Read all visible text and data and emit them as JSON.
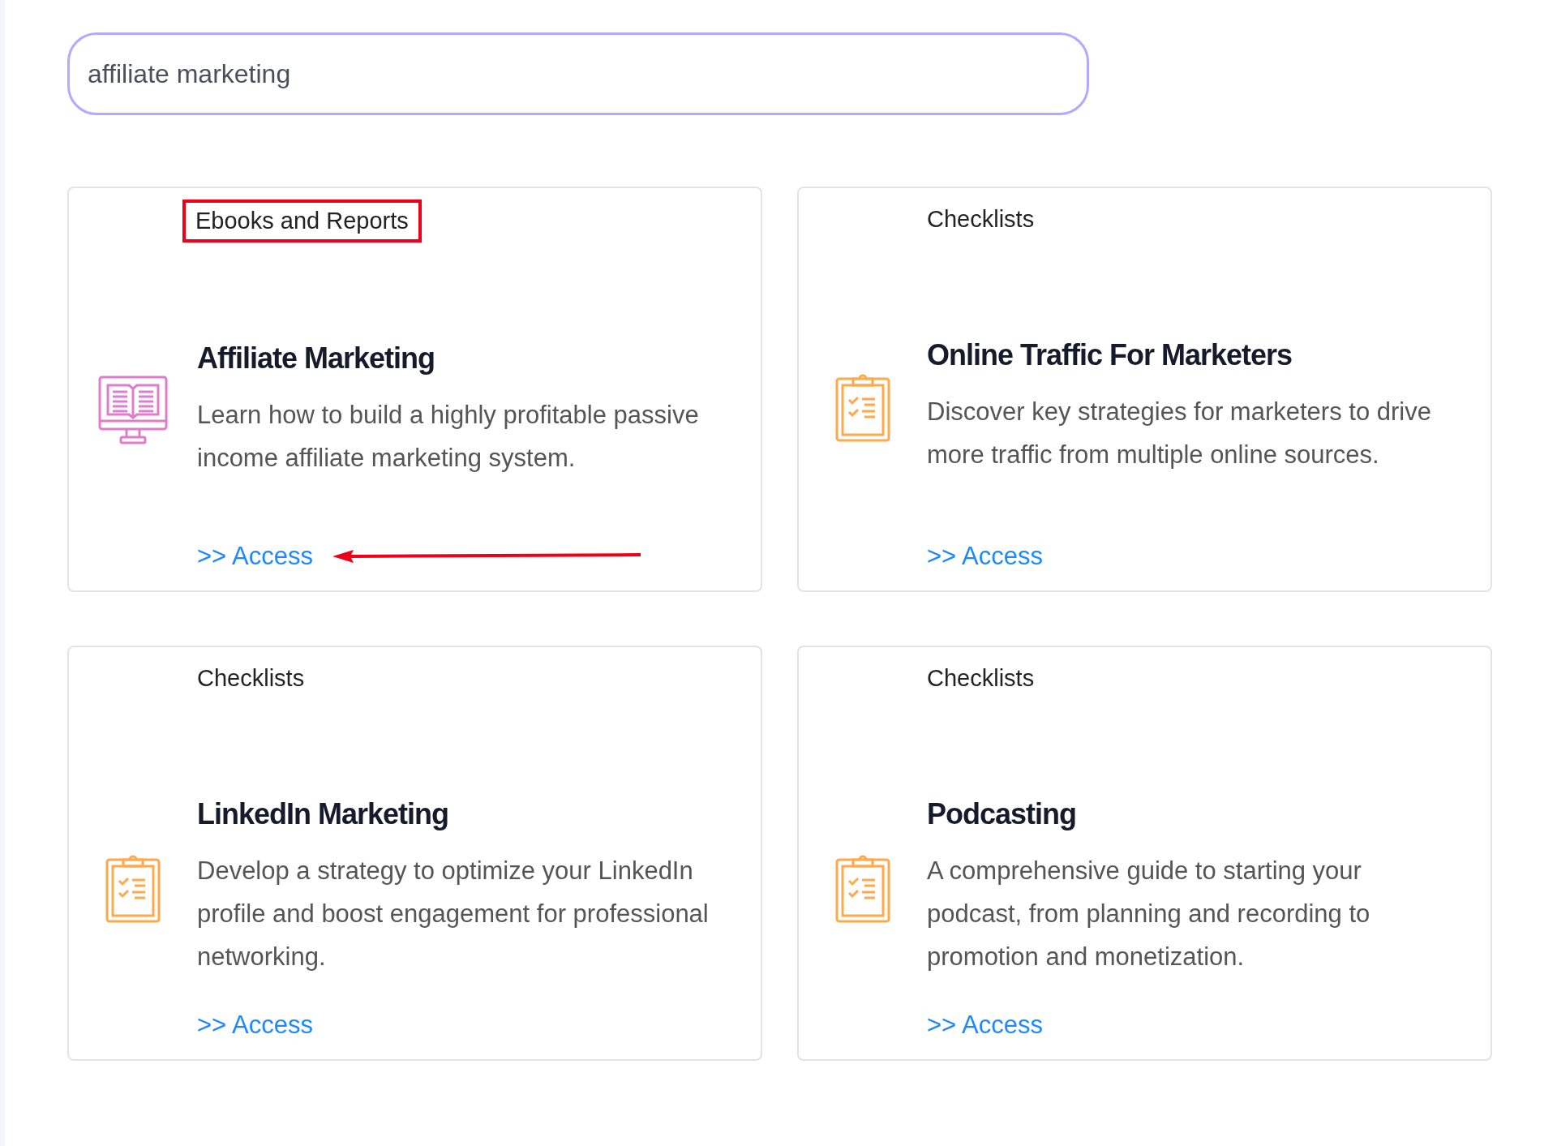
{
  "search": {
    "value": "affiliate marketing"
  },
  "cards": [
    {
      "category": "Ebooks and Reports",
      "highlighted": true,
      "kind": "ebook",
      "title": "Affiliate Marketing",
      "description": "Learn how to build a highly profitable passive income affiliate marketing system.",
      "link": ">> Access",
      "arrow": true
    },
    {
      "category": "Checklists",
      "highlighted": false,
      "kind": "checklist",
      "title": "Online Traffic For Marketers",
      "description": "Discover key strategies for marketers to drive more traffic from multiple online sources.",
      "link": ">> Access",
      "arrow": false
    },
    {
      "category": "Checklists",
      "highlighted": false,
      "kind": "checklist",
      "title": "LinkedIn Marketing",
      "description": "Develop a strategy to optimize your LinkedIn profile and boost engagement for professional networking.",
      "link": ">> Access",
      "arrow": false
    },
    {
      "category": "Checklists",
      "highlighted": false,
      "kind": "checklist",
      "title": "Podcasting",
      "description": "A comprehensive guide to starting your podcast, from planning and recording to promotion and monetization.",
      "link": ">> Access",
      "arrow": false
    }
  ]
}
